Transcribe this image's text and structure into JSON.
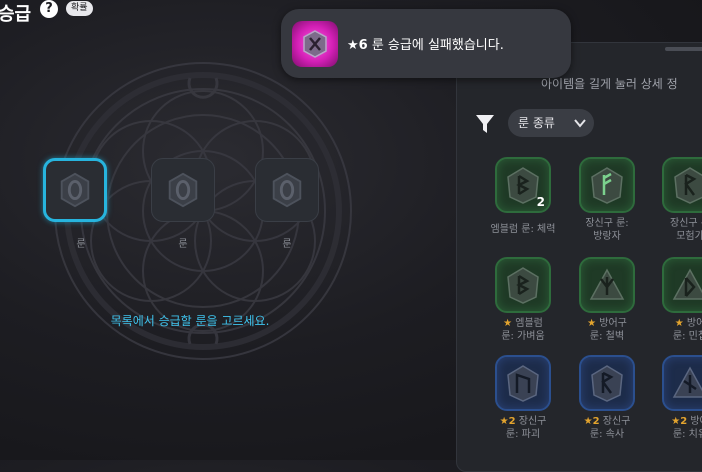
{
  "header": {
    "title": "승급",
    "help_icon": "?",
    "probability_badge": "확률"
  },
  "slots": [
    {
      "label": "룬",
      "selected": true
    },
    {
      "label": "룬",
      "selected": false
    },
    {
      "label": "룬",
      "selected": false
    }
  ],
  "hint": "목록에서 승급할 룬을 고르세요.",
  "toast": {
    "icon": "pink-rune-icon",
    "grade": "★6",
    "message": "룬 승급에 실패했습니다."
  },
  "panel": {
    "hint": "아이템을 길게 눌러 상세 정",
    "filter_label": "룬 종류",
    "items": [
      {
        "grade": "",
        "name_line1": "엠블럼 룬: 체력",
        "name_line2": "",
        "count": "2",
        "color": "green"
      },
      {
        "grade": "",
        "name_line1": "장신구 룬:",
        "name_line2": "방랑자",
        "count": "",
        "color": "green"
      },
      {
        "grade": "",
        "name_line1": "장신구 룬",
        "name_line2": "모험가",
        "count": "",
        "color": "green"
      },
      {
        "grade": "★",
        "name_line1": "엠블럼",
        "name_line2": "룬: 가벼움",
        "count": "",
        "color": "green"
      },
      {
        "grade": "★",
        "name_line1": "방어구",
        "name_line2": "룬: 철벽",
        "count": "",
        "color": "green"
      },
      {
        "grade": "★",
        "name_line1": "방어",
        "name_line2": "룬: 민첩",
        "count": "",
        "color": "green"
      },
      {
        "grade": "★2",
        "name_line1": "장신구",
        "name_line2": "룬: 파괴",
        "count": "",
        "color": "blue"
      },
      {
        "grade": "★2",
        "name_line1": "장신구",
        "name_line2": "룬: 속사",
        "count": "",
        "color": "blue"
      },
      {
        "grade": "★2",
        "name_line1": "방어",
        "name_line2": "룬: 치유",
        "count": "",
        "color": "blue"
      }
    ]
  },
  "colors": {
    "accent": "#27b4de",
    "hint": "#3fc4ee",
    "star": "#e3a42e",
    "toast_icon": "#d21fb5"
  }
}
